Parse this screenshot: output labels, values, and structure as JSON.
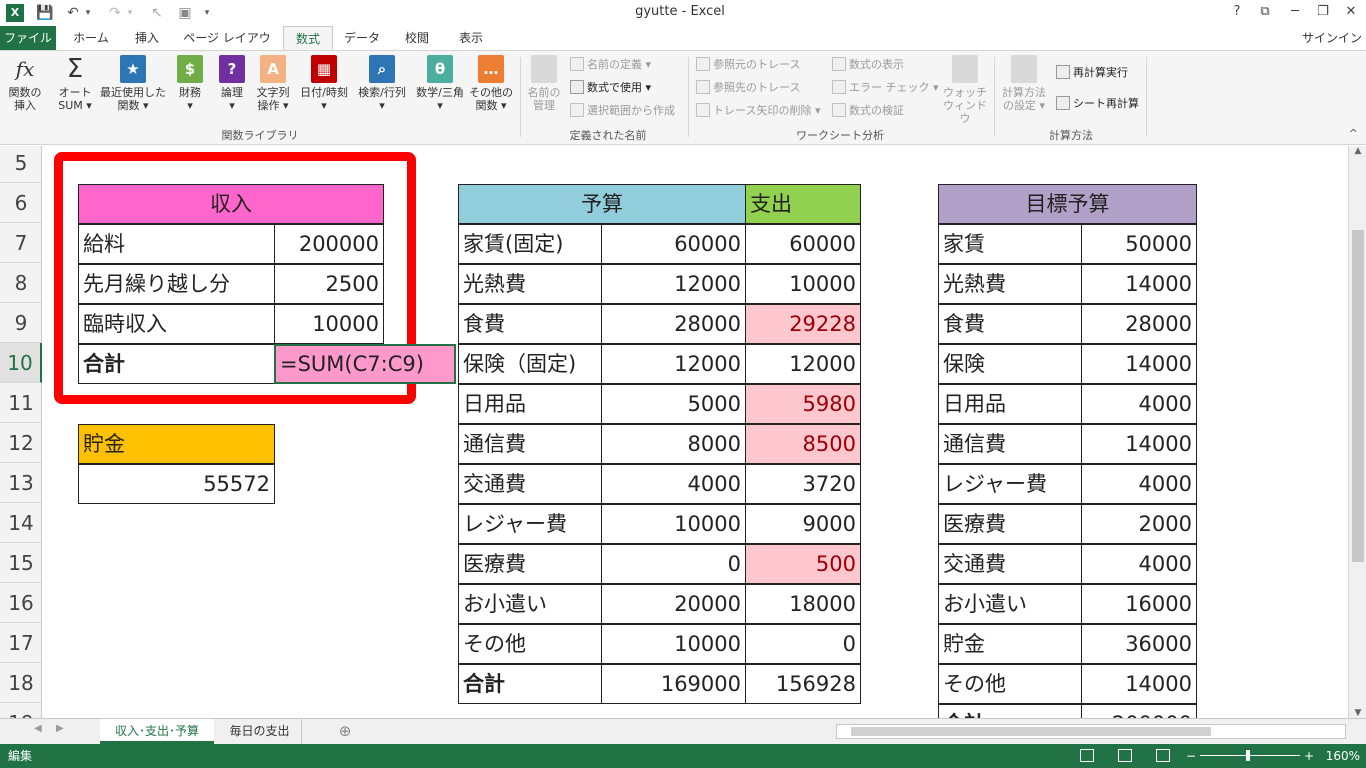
{
  "window": {
    "title": "gyutte - Excel",
    "signin": "サインイン",
    "help": "?",
    "restore_ribbon": "⧉",
    "minimize": "─",
    "maximize": "❐",
    "close": "✕"
  },
  "quick_access": {
    "logo": "X"
  },
  "tabs": [
    "ファイル",
    "ホーム",
    "挿入",
    "ページ レイアウト",
    "数式",
    "データ",
    "校閲",
    "表示"
  ],
  "ribbon": {
    "function_library": {
      "label": "関数ライブラリ",
      "insert_function": {
        "icon": "fx",
        "line1": "関数の",
        "line2": "挿入"
      },
      "autosum": {
        "icon": "Σ",
        "line1": "オート",
        "line2": "SUM ▾"
      },
      "recent": {
        "icon": "★",
        "line1": "最近使用した",
        "line2": "関数 ▾"
      },
      "financial": {
        "icon": "$",
        "line1": "財務",
        "line2": "▾"
      },
      "logical": {
        "icon": "?",
        "line1": "論理",
        "line2": "▾"
      },
      "text": {
        "icon": "A",
        "line1": "文字列",
        "line2": "操作 ▾"
      },
      "datetime": {
        "icon": "▦",
        "line1": "日付/時刻",
        "line2": "▾"
      },
      "lookup": {
        "icon": "⌕",
        "line1": "検索/行列",
        "line2": "▾"
      },
      "math": {
        "icon": "θ",
        "line1": "数学/三角",
        "line2": "▾"
      },
      "other": {
        "icon": "…",
        "line1": "その他の",
        "line2": "関数 ▾"
      }
    },
    "defined_names": {
      "label": "定義された名前",
      "name_manager": {
        "line1": "名前の",
        "line2": "管理"
      },
      "define_name": "名前の定義 ▾",
      "use_in_formula": "数式で使用 ▾",
      "create_from_selection": "選択範囲から作成"
    },
    "formula_auditing": {
      "label": "ワークシート分析",
      "trace_precedents": "参照元のトレース",
      "trace_dependents": "参照先のトレース",
      "remove_arrows": "トレース矢印の削除 ▾",
      "show_formulas": "数式の表示",
      "error_checking": "エラー チェック ▾",
      "evaluate_formula": "数式の検証",
      "watch_window": {
        "line1": "ウォッチ",
        "line2": "ウィンドウ"
      }
    },
    "calculation": {
      "label": "計算方法",
      "options": {
        "line1": "計算方法",
        "line2": "の設定 ▾"
      },
      "calc_now": "再計算実行",
      "calc_sheet": "シート再計算"
    },
    "collapse": "^"
  },
  "rows": [
    "5",
    "6",
    "7",
    "8",
    "9",
    "10",
    "11",
    "12",
    "13",
    "14",
    "15",
    "16",
    "17",
    "18",
    "19"
  ],
  "selected_row": "10",
  "income": {
    "header": "収入",
    "items": [
      {
        "label": "給料",
        "value": "200000"
      },
      {
        "label": "先月繰り越し分",
        "value": "2500"
      },
      {
        "label": "臨時収入",
        "value": "10000"
      }
    ],
    "total_label": "合計",
    "total_formula": "=SUM(C7:C9)"
  },
  "savings": {
    "header": "貯金",
    "value": "55572"
  },
  "budget": {
    "header_budget": "予算",
    "header_expense": "支出",
    "rows": [
      {
        "label": "家賃(固定)",
        "budget": "60000",
        "expense": "60000",
        "over": false
      },
      {
        "label": "光熱費",
        "budget": "12000",
        "expense": "10000",
        "over": false
      },
      {
        "label": "食費",
        "budget": "28000",
        "expense": "29228",
        "over": true
      },
      {
        "label": "保険（固定)",
        "budget": "12000",
        "expense": "12000",
        "over": false
      },
      {
        "label": "日用品",
        "budget": "5000",
        "expense": "5980",
        "over": true
      },
      {
        "label": "通信費",
        "budget": "8000",
        "expense": "8500",
        "over": true
      },
      {
        "label": "交通費",
        "budget": "4000",
        "expense": "3720",
        "over": false
      },
      {
        "label": "レジャー費",
        "budget": "10000",
        "expense": "9000",
        "over": false
      },
      {
        "label": "医療費",
        "budget": "0",
        "expense": "500",
        "over": true
      },
      {
        "label": "お小遣い",
        "budget": "20000",
        "expense": "18000",
        "over": false
      },
      {
        "label": "その他",
        "budget": "10000",
        "expense": "0",
        "over": false
      }
    ],
    "total": {
      "label": "合計",
      "budget": "169000",
      "expense": "156928"
    }
  },
  "target": {
    "header": "目標予算",
    "rows": [
      {
        "label": "家賃",
        "value": "50000"
      },
      {
        "label": "光熱費",
        "value": "14000"
      },
      {
        "label": "食費",
        "value": "28000"
      },
      {
        "label": "保険",
        "value": "14000"
      },
      {
        "label": "日用品",
        "value": "4000"
      },
      {
        "label": "通信費",
        "value": "14000"
      },
      {
        "label": "レジャー費",
        "value": "4000"
      },
      {
        "label": "医療費",
        "value": "2000"
      },
      {
        "label": "交通費",
        "value": "4000"
      },
      {
        "label": "お小遣い",
        "value": "16000"
      },
      {
        "label": "貯金",
        "value": "36000"
      },
      {
        "label": "その他",
        "value": "14000"
      }
    ],
    "total": {
      "label": "合計",
      "value": "200000"
    }
  },
  "sheets": [
    "収入･支出･予算",
    "毎日の支出"
  ],
  "add_sheet": "⊕",
  "status": {
    "mode": "編集",
    "zoom": "160%",
    "zoom_minus": "−",
    "zoom_plus": "+"
  },
  "colors": {
    "income_header": "#ff66cc",
    "budget_header": "#92cddc",
    "expense_header": "#92d050",
    "target_header": "#b1a0c7",
    "savings_header": "#ffc000",
    "over_fill": "#ffc7ce",
    "over_text": "#9c0006",
    "formula_fill": "#ff99cc",
    "highlight_border": "#ff0000",
    "excel_green": "#217346"
  }
}
